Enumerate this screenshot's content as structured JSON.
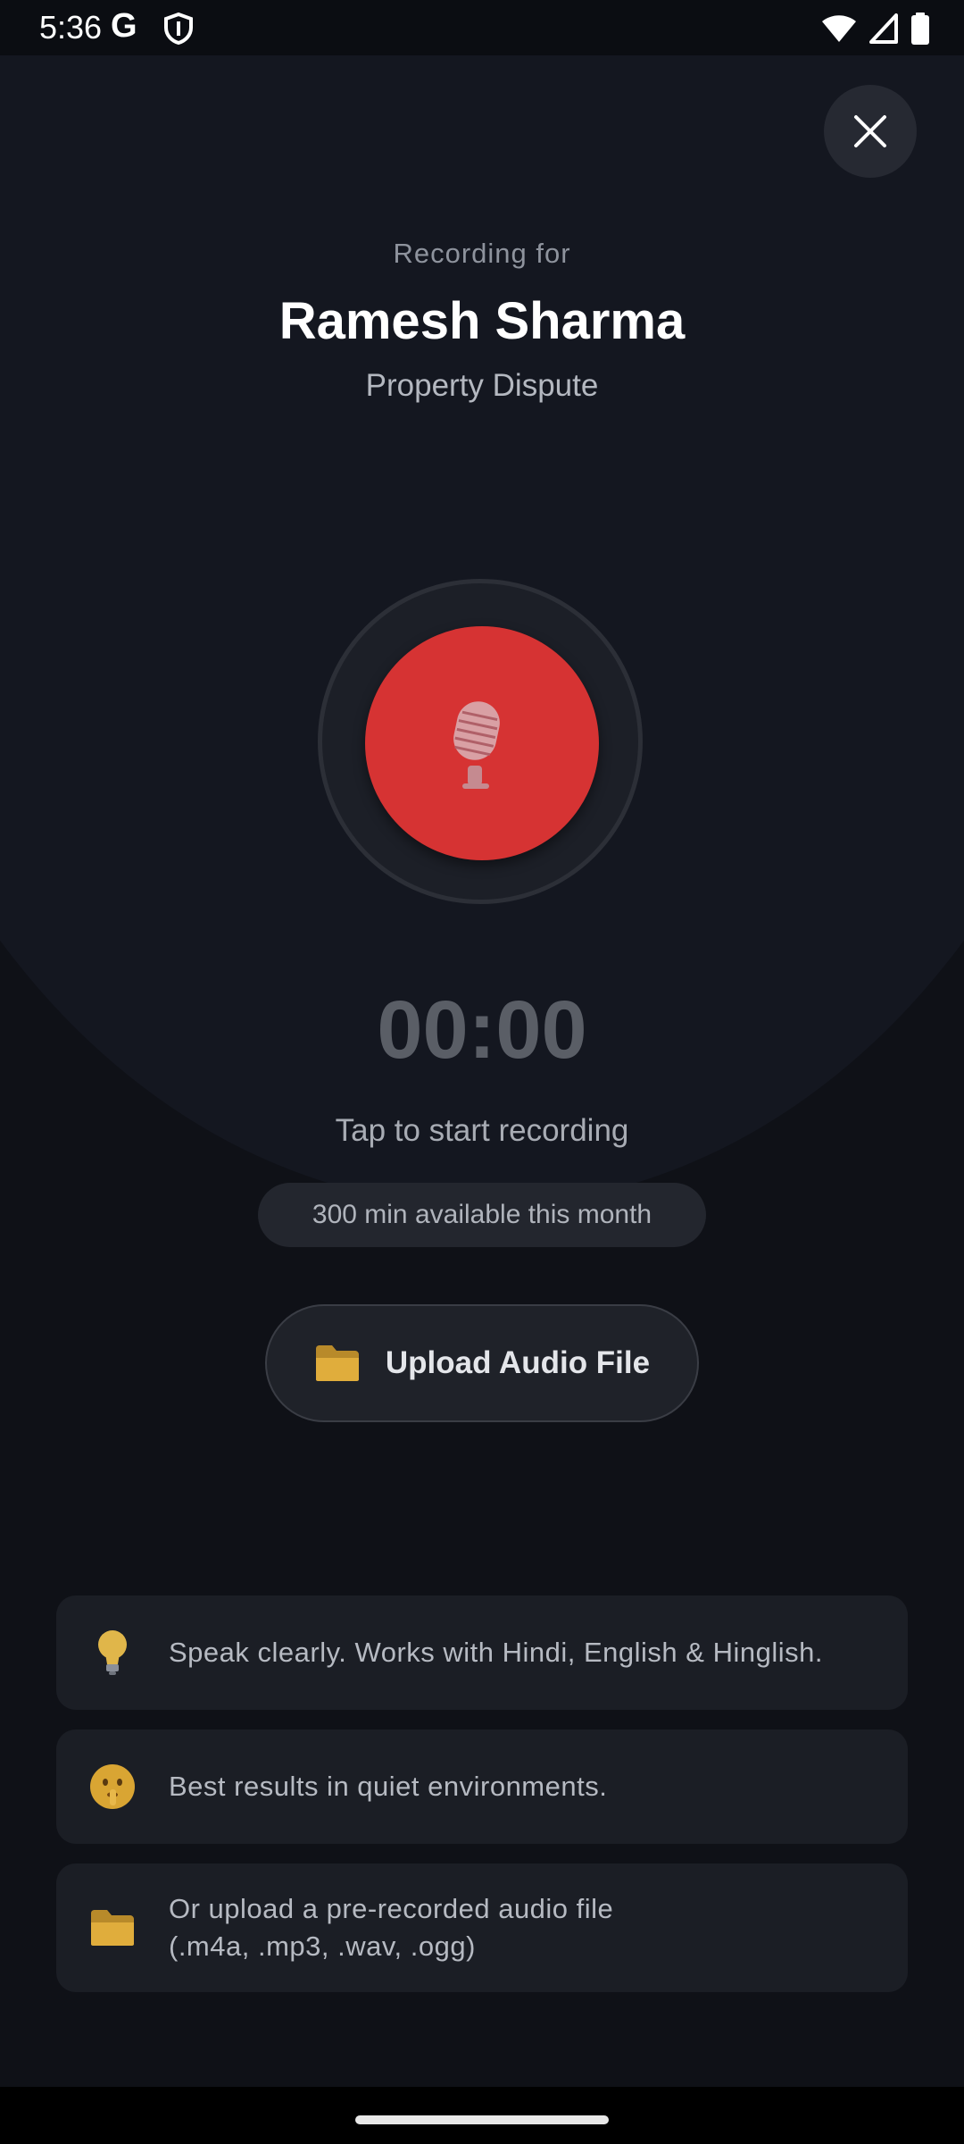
{
  "status_bar": {
    "time": "5:36",
    "g_label": "G",
    "icons": [
      "google-icon",
      "shield-icon",
      "wifi-icon",
      "signal-icon",
      "battery-icon"
    ]
  },
  "header": {
    "recording_for": "Recording for",
    "client_name": "Ramesh Sharma",
    "case_type": "Property Dispute"
  },
  "recorder": {
    "timer": "00:00",
    "hint": "Tap to start recording",
    "quota": "300 min available this month",
    "mic_icon": "microphone-icon",
    "accent_color": "#d63333"
  },
  "upload": {
    "label": "Upload Audio File",
    "icon": "folder-icon"
  },
  "tips": [
    {
      "icon": "lightbulb-icon",
      "text": "Speak clearly. Works with Hindi, English & Hinglish."
    },
    {
      "icon": "shushing-face-icon",
      "text": "Best results in quiet environments."
    },
    {
      "icon": "folder-icon",
      "line1": "Or upload a pre-recorded audio file",
      "line2": "(.m4a, .mp3, .wav, .ogg)"
    }
  ]
}
